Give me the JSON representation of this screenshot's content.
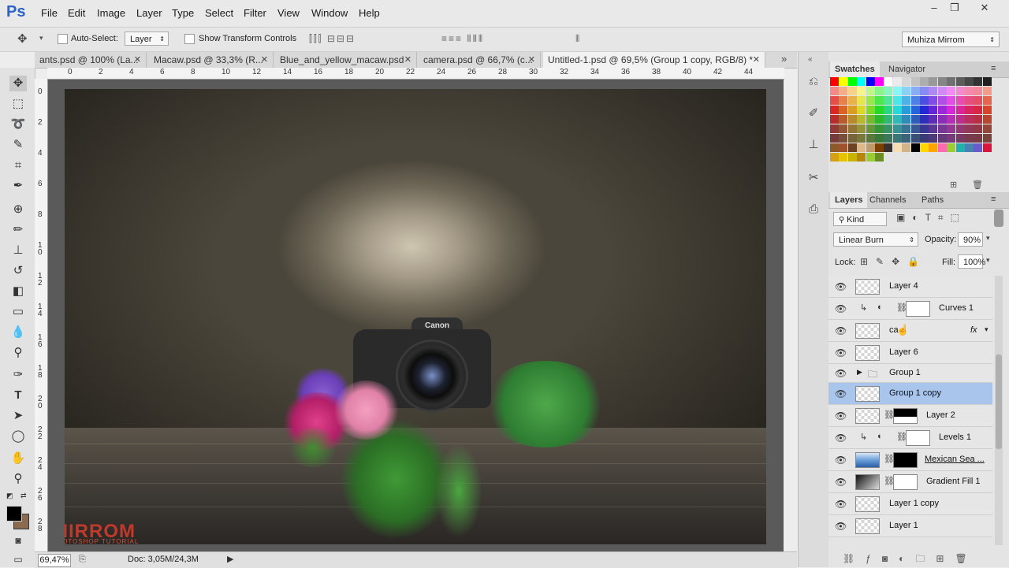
{
  "app": {
    "logo": "Ps"
  },
  "menu": [
    "File",
    "Edit",
    "Image",
    "Layer",
    "Type",
    "Select",
    "Filter",
    "View",
    "Window",
    "Help"
  ],
  "window_buttons": [
    "–",
    "❐",
    "✕"
  ],
  "options": {
    "auto_select_label": "Auto-Select:",
    "auto_select_value": "Layer",
    "show_transform_label": "Show Transform Controls",
    "workspace": "Muhiza Mirrom"
  },
  "tabs": [
    {
      "label": "ants.psd @ 100% (La...",
      "close": "✕"
    },
    {
      "label": "Macaw.psd @ 33,3% (R...",
      "close": "✕"
    },
    {
      "label": "Blue_and_yellow_macaw.psd",
      "close": "✕"
    },
    {
      "label": "camera.psd @ 66,7% (c...",
      "close": "✕"
    },
    {
      "label": "Untitled-1.psd @ 69,5% (Group 1 copy, RGB/8) *",
      "close": "✕"
    }
  ],
  "tab_overflow": "»",
  "ruler_h": [
    "0",
    "2",
    "4",
    "6",
    "8",
    "10",
    "12",
    "14",
    "16",
    "18",
    "20",
    "22",
    "24",
    "26",
    "28",
    "30",
    "32",
    "34",
    "36",
    "38",
    "40",
    "42",
    "44"
  ],
  "ruler_v": [
    "0",
    "2",
    "4",
    "6",
    "8",
    "1\n0",
    "1\n2",
    "1\n4",
    "1\n6",
    "1\n8",
    "2\n0",
    "2\n2",
    "2\n4",
    "2\n6",
    "2\n8"
  ],
  "canvas": {
    "brand": "Canon",
    "logo_main": "MIRROM",
    "logo_sub": "PHOTOSHOP TUTORIAL"
  },
  "status": {
    "zoom": "69,47%",
    "doc": "Doc: 3,05M/24,3M"
  },
  "swatches_panel": {
    "tabs": [
      "Swatches",
      "Navigator"
    ]
  },
  "layers_panel": {
    "tabs": [
      "Layers",
      "Channels",
      "Paths"
    ],
    "filter": "Kind",
    "blend_mode": "Linear Burn",
    "opacity_label": "Opacity:",
    "opacity": "90%",
    "lock_label": "Lock:",
    "fill_label": "Fill:",
    "fill": "100%",
    "layers": [
      {
        "name": "Layer 4"
      },
      {
        "name": "Curves 1"
      },
      {
        "name": "ca...",
        "fx": "fx"
      },
      {
        "name": "Layer 6"
      },
      {
        "name": "Group 1"
      },
      {
        "name": "Group 1 copy"
      },
      {
        "name": "Layer 2"
      },
      {
        "name": "Levels 1"
      },
      {
        "name": "Mexican Sea ..."
      },
      {
        "name": "Gradient Fill 1"
      },
      {
        "name": "Layer 1 copy"
      },
      {
        "name": "Layer 1"
      }
    ]
  }
}
